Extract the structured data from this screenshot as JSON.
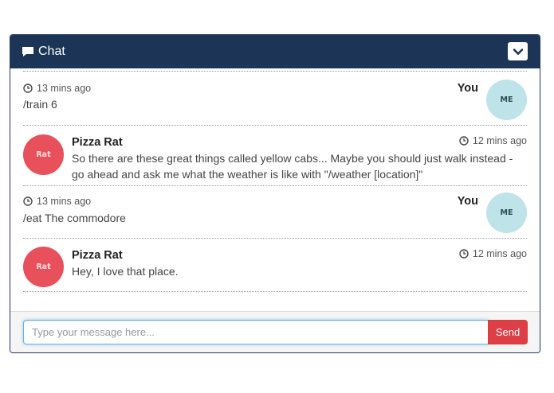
{
  "header": {
    "title": "Chat",
    "icon": "comment-icon",
    "toggle_icon": "chevron-down-icon"
  },
  "messages": [
    {
      "sender": "You",
      "avatar": "ME",
      "time": "13 mins ago",
      "text": "/train 6",
      "side": "right"
    },
    {
      "sender": "Pizza Rat",
      "avatar": "Rat",
      "time": "12 mins ago",
      "text": "So there are these great things called yellow cabs... Maybe you should just walk instead - go ahead and ask me what the weather is like with \"/weather [location]\"",
      "side": "left"
    },
    {
      "sender": "You",
      "avatar": "ME",
      "time": "13 mins ago",
      "text": "/eat The commodore",
      "side": "right"
    },
    {
      "sender": "Pizza Rat",
      "avatar": "Rat",
      "time": "12 mins ago",
      "text": "Hey, I love that place.",
      "side": "left"
    }
  ],
  "footer": {
    "placeholder": "Type your message here...",
    "send_label": "Send"
  },
  "colors": {
    "header_bg": "#1c3557",
    "rat_avatar": "#e8505b",
    "me_avatar": "#bee3e8",
    "send_button": "#de3e45"
  }
}
